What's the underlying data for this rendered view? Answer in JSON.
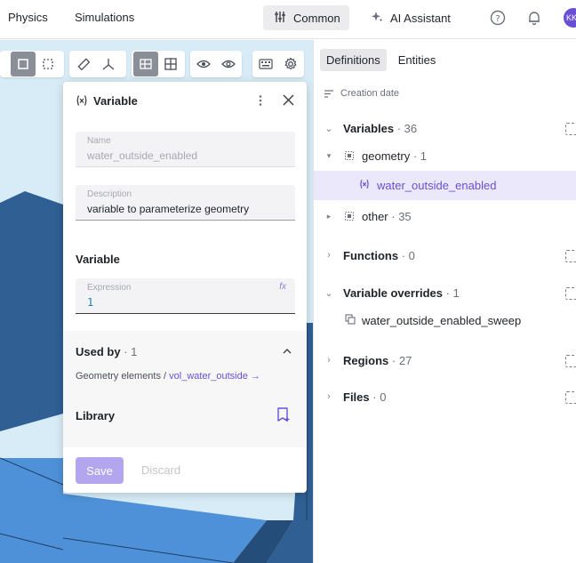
{
  "topbar": {
    "nav": [
      "Physics",
      "Simulations"
    ],
    "common_label": "Common",
    "ai_label": "AI Assistant",
    "avatar_initials": "KK"
  },
  "panel": {
    "title": "Variable",
    "name_label": "Name",
    "name_value": "water_outside_enabled",
    "description_label": "Description",
    "description_value": "variable to parameterize geometry",
    "variable_heading": "Variable",
    "expression_label": "Expression",
    "expression_value": "1",
    "fx_label": "fx",
    "used_by_heading": "Used by",
    "used_by_count": "1",
    "used_by_prefix": "Geometry elements /",
    "used_by_link": "vol_water_outside →",
    "library_heading": "Library",
    "save_label": "Save",
    "discard_label": "Discard"
  },
  "right": {
    "tabs": [
      "Definitions",
      "Entities"
    ],
    "sort_label": "Creation date",
    "tree": {
      "variables": {
        "label": "Variables",
        "count": "36"
      },
      "geometry": {
        "label": "geometry",
        "count": "1"
      },
      "selected_item": "water_outside_enabled",
      "other": {
        "label": "other",
        "count": "35"
      },
      "functions": {
        "label": "Functions",
        "count": "0"
      },
      "overrides": {
        "label": "Variable overrides",
        "count": "1"
      },
      "override_item": "water_outside_enabled_sweep",
      "regions": {
        "label": "Regions",
        "count": "27"
      },
      "files": {
        "label": "Files",
        "count": "0"
      }
    }
  },
  "colors": {
    "accent": "#6a4fd6",
    "selected_row": "#ece8fb",
    "viewport_bg": "#d8ecf7",
    "model_dark": "#2f5f93",
    "model_light": "#4f91d8"
  }
}
